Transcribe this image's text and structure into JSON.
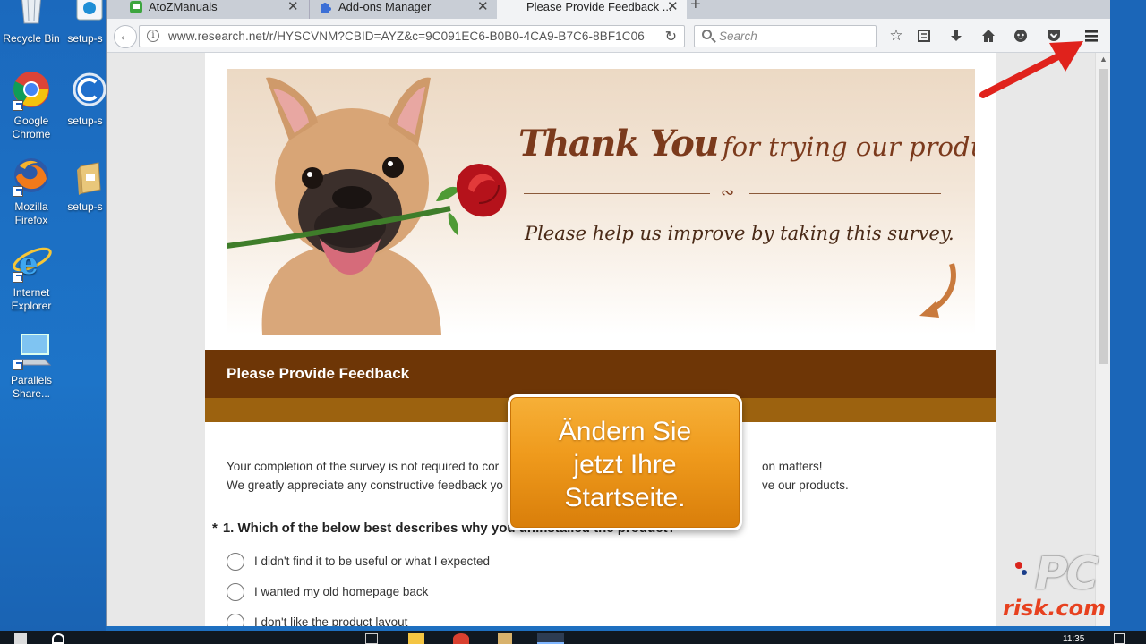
{
  "desktop": {
    "icons": [
      {
        "label": "Recycle Bin"
      },
      {
        "label": "setup-s"
      },
      {
        "label": "Google Chrome"
      },
      {
        "label": "setup-s"
      },
      {
        "label": "Mozilla Firefox"
      },
      {
        "label": "setup-s"
      },
      {
        "label": "Internet Explorer"
      },
      {
        "label": "Parallels Share..."
      }
    ]
  },
  "browser": {
    "tabs": [
      {
        "title": "AtoZManuals",
        "active": false
      },
      {
        "title": "Add-ons Manager",
        "active": false
      },
      {
        "title": "Please Provide Feedback ...",
        "active": true
      }
    ],
    "new_tab_label": "+",
    "url": "www.research.net/r/HYSCVNM?CBID=AYZ&c=9C091EC6-B0B0-4CA9-B7C6-8BF1C06",
    "search_placeholder": "Search",
    "toolbar_icons": [
      "bookmark-star-icon",
      "reading-list-icon",
      "download-icon",
      "home-icon",
      "chat-icon",
      "pocket-icon",
      "menu-icon"
    ]
  },
  "page": {
    "banner": {
      "thank": "Thank You",
      "rest": "for trying our product!",
      "please": "Please help us improve by taking this survey."
    },
    "feedback_heading": "Please Provide Feedback",
    "intro_line1": "Your completion of the survey is not required to cor",
    "intro_line1_tail": "on matters!",
    "intro_line2": "We greatly appreciate any constructive feedback yo",
    "intro_line2_tail": "ve our products.",
    "question": {
      "asterisk": "*",
      "text": "1. Which of the below best describes why you uninstalled the product?",
      "options": [
        "I didn't find it to be useful or what I expected",
        "I wanted my old homepage back",
        "I don't like the product layout"
      ]
    }
  },
  "overlay": {
    "callout_text": [
      "Ändern Sie",
      "jetzt Ihre",
      "Startseite."
    ]
  },
  "watermark": {
    "line1": "PC",
    "line2": "risk.com"
  },
  "taskbar": {
    "clock": "11:35"
  },
  "colors": {
    "desktop_blue": "#1b69bd",
    "header_brown": "#6e3606",
    "band_brown": "#9c620f",
    "callout_orange": "#ef9a1c",
    "arrow_red": "#e0221c"
  }
}
